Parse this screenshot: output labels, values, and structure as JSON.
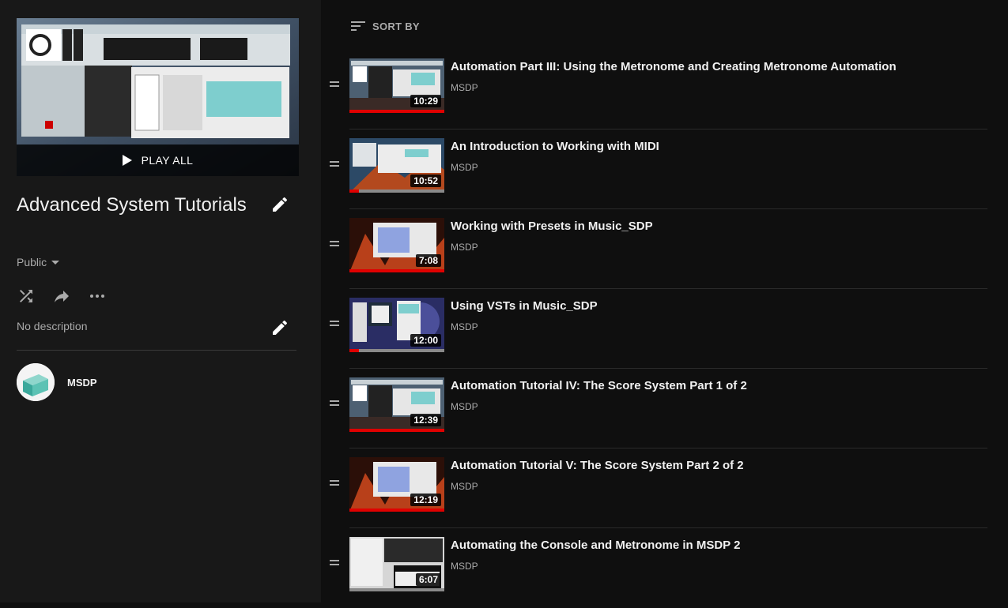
{
  "playlist": {
    "title": "Advanced System Tutorials",
    "play_all_label": "PLAY ALL",
    "privacy": "Public",
    "description": "No description",
    "owner": "MSDP"
  },
  "icons": {
    "edit": "pencil-icon",
    "privacy_dropdown": "caret-down-icon",
    "shuffle": "shuffle-icon",
    "share": "share-icon",
    "more": "more-horizontal-icon",
    "sort": "sort-icon",
    "drag": "drag-handle-icon",
    "play": "play-icon"
  },
  "sort_label": "SORT BY",
  "colors": {
    "progress": "#e00000",
    "background": "#0f0f0f",
    "sidebar": "#181818"
  },
  "videos": [
    {
      "title": "Automation Part III: Using the Metronome and Creating Metronome Automation",
      "channel": "MSDP",
      "duration": "10:29",
      "progress": 1.0,
      "theme": "teal"
    },
    {
      "title": "An Introduction to Working with MIDI",
      "channel": "MSDP",
      "duration": "10:52",
      "progress": 0.1,
      "theme": "mountain"
    },
    {
      "title": "Working with Presets in Music_SDP",
      "channel": "MSDP",
      "duration": "7:08",
      "progress": 1.0,
      "theme": "fire"
    },
    {
      "title": "Using VSTs in Music_SDP",
      "channel": "MSDP",
      "duration": "12:00",
      "progress": 0.1,
      "theme": "purple"
    },
    {
      "title": "Automation Tutorial IV: The Score System Part 1 of 2",
      "channel": "MSDP",
      "duration": "12:39",
      "progress": 1.0,
      "theme": "teal"
    },
    {
      "title": "Automation Tutorial V: The Score System Part 2 of 2",
      "channel": "MSDP",
      "duration": "12:19",
      "progress": 1.0,
      "theme": "fire"
    },
    {
      "title": "Automating the Console and Metronome in MSDP 2",
      "channel": "MSDP",
      "duration": "6:07",
      "progress": 0,
      "theme": "keys"
    }
  ]
}
